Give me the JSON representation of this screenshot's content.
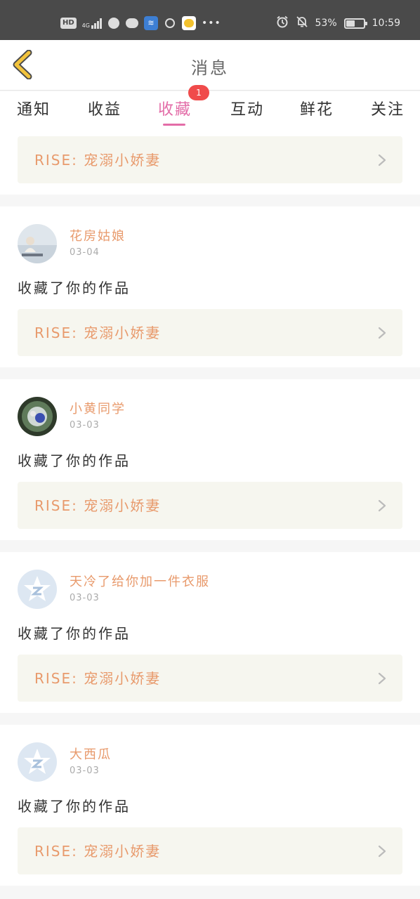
{
  "status_bar": {
    "left_label": "HD",
    "network": "4G",
    "battery": "53%",
    "time": "10:59",
    "icons": [
      "hd-icon",
      "signal-icon",
      "globe-icon",
      "wechat-icon",
      "blue-app-icon",
      "search-icon",
      "yellow-app-icon",
      "more-icon",
      "alarm-icon",
      "mute-icon",
      "battery-icon"
    ]
  },
  "header": {
    "title": "消息",
    "back_icon": "chevron-left-icon",
    "accent_color": "#f2c33c"
  },
  "tabs": {
    "items": [
      {
        "label": "通知"
      },
      {
        "label": "收益"
      },
      {
        "label": "收藏"
      },
      {
        "label": "互动"
      },
      {
        "label": "鲜花"
      },
      {
        "label": "关注"
      }
    ],
    "active_index": 2,
    "active_color": "#e36da8",
    "badge": "1"
  },
  "feed": {
    "top_work": "RISE: 宠溺小娇妻",
    "items": [
      {
        "user": "花房姑娘",
        "date": "03-04",
        "action": "收藏了你的作品",
        "work": "RISE: 宠溺小娇妻",
        "avatar": "photo-avatar"
      },
      {
        "user": "小黄同学",
        "date": "03-03",
        "action": "收藏了你的作品",
        "work": "RISE: 宠溺小娇妻",
        "avatar": "photo-avatar"
      },
      {
        "user": "天冷了给你加一件衣服",
        "date": "03-03",
        "action": "收藏了你的作品",
        "work": "RISE: 宠溺小娇妻",
        "avatar": "default-qq-avatar"
      },
      {
        "user": "大西瓜",
        "date": "03-03",
        "action": "收藏了你的作品",
        "work": "RISE: 宠溺小娇妻",
        "avatar": "default-qq-avatar"
      }
    ]
  }
}
